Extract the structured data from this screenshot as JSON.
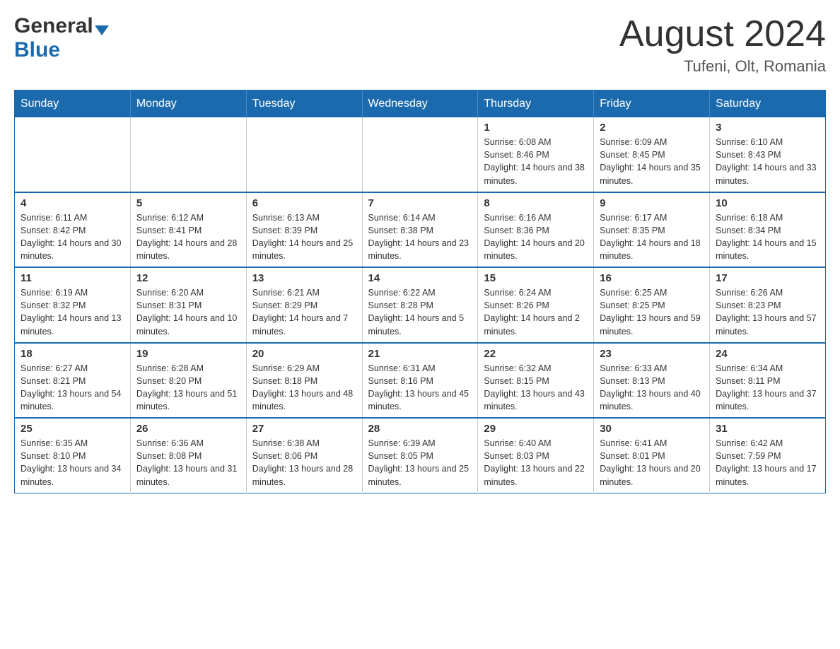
{
  "header": {
    "logo_general": "General",
    "logo_blue": "Blue",
    "month_title": "August 2024",
    "location": "Tufeni, Olt, Romania"
  },
  "days_of_week": [
    "Sunday",
    "Monday",
    "Tuesday",
    "Wednesday",
    "Thursday",
    "Friday",
    "Saturday"
  ],
  "weeks": [
    [
      {
        "day": "",
        "info": ""
      },
      {
        "day": "",
        "info": ""
      },
      {
        "day": "",
        "info": ""
      },
      {
        "day": "",
        "info": ""
      },
      {
        "day": "1",
        "info": "Sunrise: 6:08 AM\nSunset: 8:46 PM\nDaylight: 14 hours and 38 minutes."
      },
      {
        "day": "2",
        "info": "Sunrise: 6:09 AM\nSunset: 8:45 PM\nDaylight: 14 hours and 35 minutes."
      },
      {
        "day": "3",
        "info": "Sunrise: 6:10 AM\nSunset: 8:43 PM\nDaylight: 14 hours and 33 minutes."
      }
    ],
    [
      {
        "day": "4",
        "info": "Sunrise: 6:11 AM\nSunset: 8:42 PM\nDaylight: 14 hours and 30 minutes."
      },
      {
        "day": "5",
        "info": "Sunrise: 6:12 AM\nSunset: 8:41 PM\nDaylight: 14 hours and 28 minutes."
      },
      {
        "day": "6",
        "info": "Sunrise: 6:13 AM\nSunset: 8:39 PM\nDaylight: 14 hours and 25 minutes."
      },
      {
        "day": "7",
        "info": "Sunrise: 6:14 AM\nSunset: 8:38 PM\nDaylight: 14 hours and 23 minutes."
      },
      {
        "day": "8",
        "info": "Sunrise: 6:16 AM\nSunset: 8:36 PM\nDaylight: 14 hours and 20 minutes."
      },
      {
        "day": "9",
        "info": "Sunrise: 6:17 AM\nSunset: 8:35 PM\nDaylight: 14 hours and 18 minutes."
      },
      {
        "day": "10",
        "info": "Sunrise: 6:18 AM\nSunset: 8:34 PM\nDaylight: 14 hours and 15 minutes."
      }
    ],
    [
      {
        "day": "11",
        "info": "Sunrise: 6:19 AM\nSunset: 8:32 PM\nDaylight: 14 hours and 13 minutes."
      },
      {
        "day": "12",
        "info": "Sunrise: 6:20 AM\nSunset: 8:31 PM\nDaylight: 14 hours and 10 minutes."
      },
      {
        "day": "13",
        "info": "Sunrise: 6:21 AM\nSunset: 8:29 PM\nDaylight: 14 hours and 7 minutes."
      },
      {
        "day": "14",
        "info": "Sunrise: 6:22 AM\nSunset: 8:28 PM\nDaylight: 14 hours and 5 minutes."
      },
      {
        "day": "15",
        "info": "Sunrise: 6:24 AM\nSunset: 8:26 PM\nDaylight: 14 hours and 2 minutes."
      },
      {
        "day": "16",
        "info": "Sunrise: 6:25 AM\nSunset: 8:25 PM\nDaylight: 13 hours and 59 minutes."
      },
      {
        "day": "17",
        "info": "Sunrise: 6:26 AM\nSunset: 8:23 PM\nDaylight: 13 hours and 57 minutes."
      }
    ],
    [
      {
        "day": "18",
        "info": "Sunrise: 6:27 AM\nSunset: 8:21 PM\nDaylight: 13 hours and 54 minutes."
      },
      {
        "day": "19",
        "info": "Sunrise: 6:28 AM\nSunset: 8:20 PM\nDaylight: 13 hours and 51 minutes."
      },
      {
        "day": "20",
        "info": "Sunrise: 6:29 AM\nSunset: 8:18 PM\nDaylight: 13 hours and 48 minutes."
      },
      {
        "day": "21",
        "info": "Sunrise: 6:31 AM\nSunset: 8:16 PM\nDaylight: 13 hours and 45 minutes."
      },
      {
        "day": "22",
        "info": "Sunrise: 6:32 AM\nSunset: 8:15 PM\nDaylight: 13 hours and 43 minutes."
      },
      {
        "day": "23",
        "info": "Sunrise: 6:33 AM\nSunset: 8:13 PM\nDaylight: 13 hours and 40 minutes."
      },
      {
        "day": "24",
        "info": "Sunrise: 6:34 AM\nSunset: 8:11 PM\nDaylight: 13 hours and 37 minutes."
      }
    ],
    [
      {
        "day": "25",
        "info": "Sunrise: 6:35 AM\nSunset: 8:10 PM\nDaylight: 13 hours and 34 minutes."
      },
      {
        "day": "26",
        "info": "Sunrise: 6:36 AM\nSunset: 8:08 PM\nDaylight: 13 hours and 31 minutes."
      },
      {
        "day": "27",
        "info": "Sunrise: 6:38 AM\nSunset: 8:06 PM\nDaylight: 13 hours and 28 minutes."
      },
      {
        "day": "28",
        "info": "Sunrise: 6:39 AM\nSunset: 8:05 PM\nDaylight: 13 hours and 25 minutes."
      },
      {
        "day": "29",
        "info": "Sunrise: 6:40 AM\nSunset: 8:03 PM\nDaylight: 13 hours and 22 minutes."
      },
      {
        "day": "30",
        "info": "Sunrise: 6:41 AM\nSunset: 8:01 PM\nDaylight: 13 hours and 20 minutes."
      },
      {
        "day": "31",
        "info": "Sunrise: 6:42 AM\nSunset: 7:59 PM\nDaylight: 13 hours and 17 minutes."
      }
    ]
  ]
}
